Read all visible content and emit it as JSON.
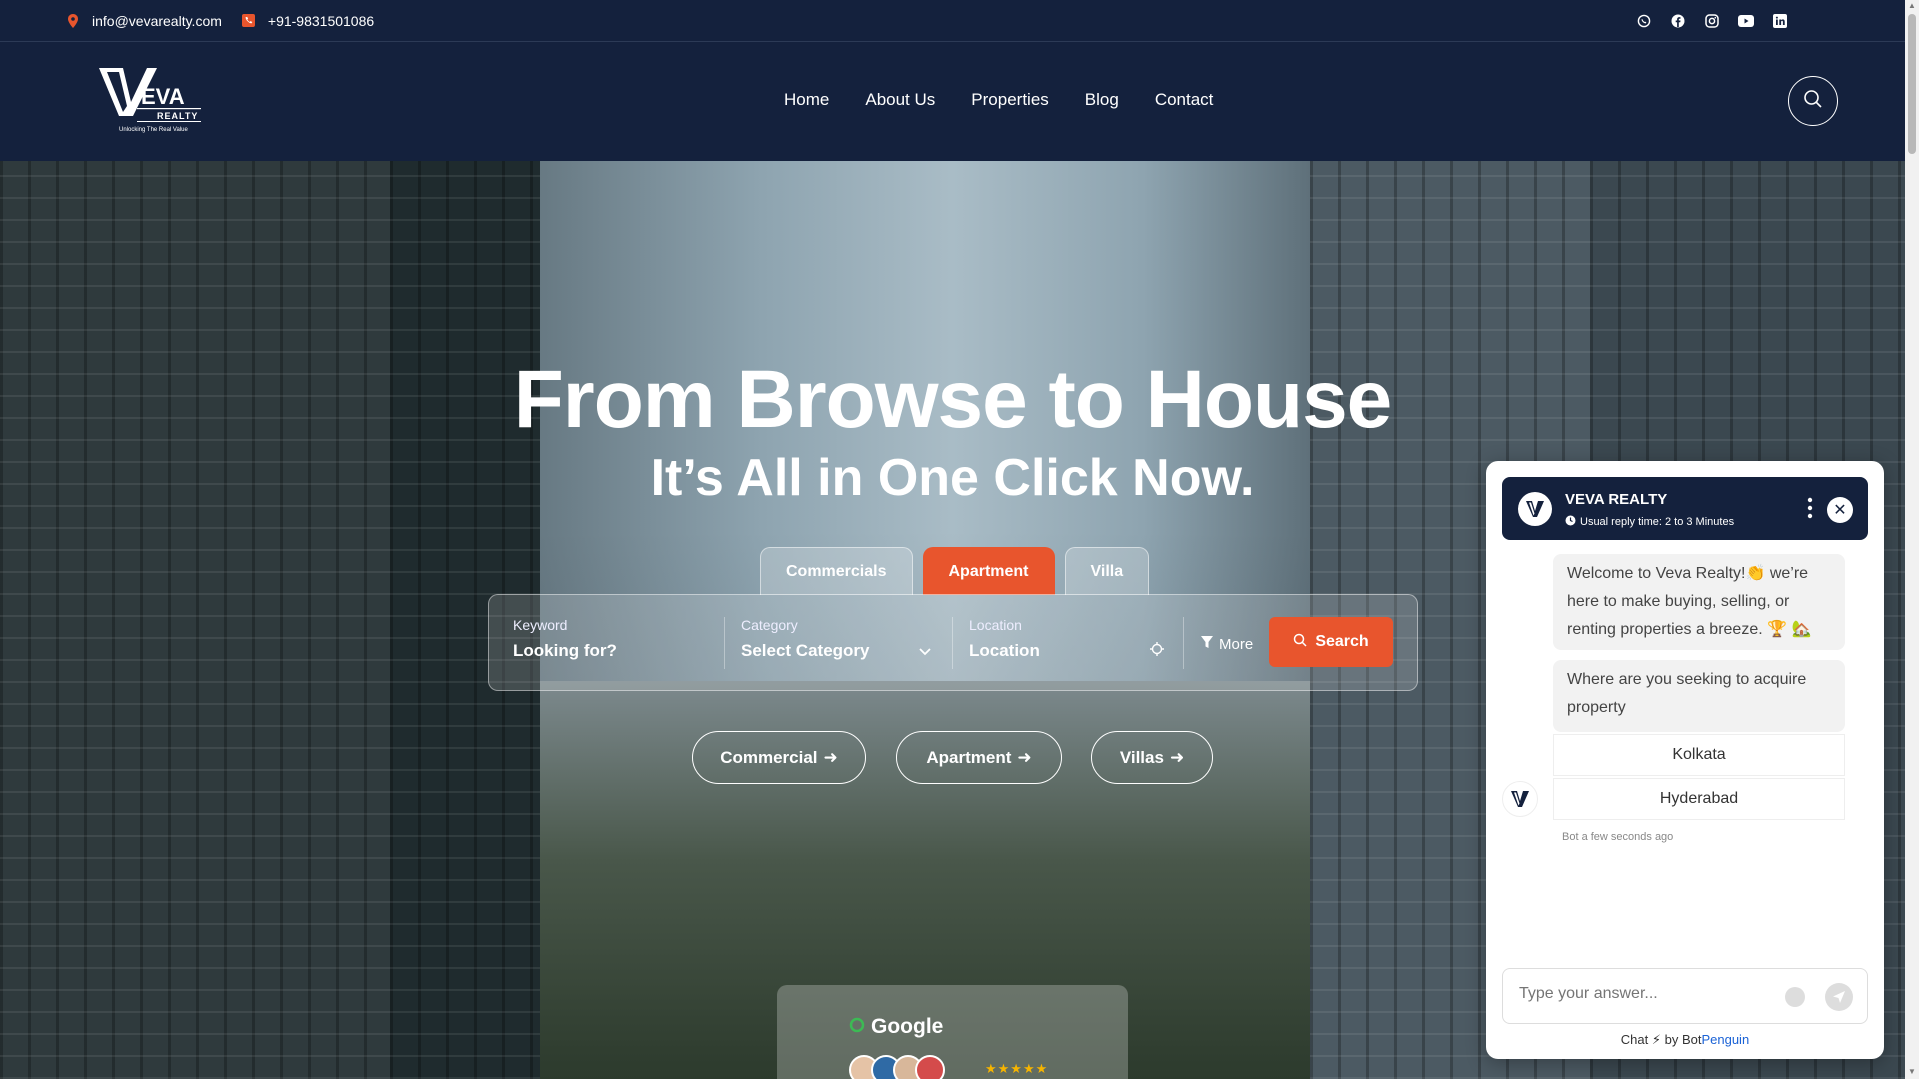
{
  "topbar": {
    "email": "info@vevarealty.com",
    "phone": "+91-9831501086",
    "social": [
      "whatsapp-icon",
      "facebook-icon",
      "instagram-icon",
      "youtube-icon",
      "linkedin-icon"
    ]
  },
  "header": {
    "logo_text": "VEVA",
    "logo_sub": "REALTY",
    "logo_tagline": "Unlocking The Real Value",
    "nav": [
      "Home",
      "About Us",
      "Properties",
      "Blog",
      "Contact"
    ]
  },
  "hero": {
    "title": "From Browse to House",
    "subtitle": "It’s All in One Click Now.",
    "tabs": [
      "Commercials",
      "Apartment",
      "Villa"
    ],
    "active_tab": "Apartment",
    "search": {
      "keyword_label": "Keyword",
      "keyword_placeholder": "Looking for?",
      "category_label": "Category",
      "category_value": "Select Category",
      "location_label": "Location",
      "location_placeholder": "Location",
      "more_label": "More",
      "search_label": "Search"
    },
    "pills": [
      "Commercial",
      "Apartment",
      "Villas"
    ],
    "google": {
      "title": "Google",
      "stars": "★★★★★"
    }
  },
  "chat": {
    "name": "VEVA REALTY",
    "reply_time": "Usual reply time: 2 to 3 Minutes",
    "welcome": "Welcome to Veva Realty!👏 we’re here to make buying, selling, or renting properties a breeze. 🏆 🏡",
    "question": "Where are you seeking to acquire property",
    "options": [
      "Kolkata",
      "Hyderabad"
    ],
    "timestamp": "Bot a few seconds ago",
    "input_placeholder": "Type your answer...",
    "footer_prefix": "Chat ⚡ by Bot",
    "footer_brand": "Penguin"
  },
  "colors": {
    "navy": "#14213d",
    "accent": "#e8552d"
  }
}
